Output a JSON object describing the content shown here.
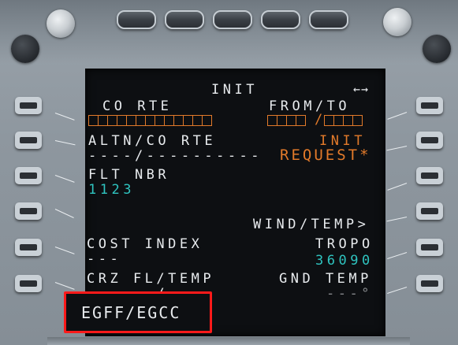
{
  "page": {
    "title": "INIT",
    "page_arrow": "←→"
  },
  "left": {
    "l1_label": "CO RTE",
    "l2_label": "ALTN/CO RTE",
    "l2_value": "----/----------",
    "l3_label": "FLT NBR",
    "l3_value": "1123",
    "l5_label": "COST INDEX",
    "l5_value": "---",
    "l6_label": "CRZ FL/TEMP",
    "l6_value": "----- /----"
  },
  "right": {
    "r1_label": "FROM/TO",
    "r2_label": "INIT",
    "r2_value": "REQUEST*",
    "r4_value": "WIND/TEMP>",
    "r5_label": "TROPO",
    "r5_value": "36090",
    "r6_label": "GND TEMP",
    "r6_value": "---°"
  },
  "scratchpad": {
    "text": "EGFF/EGCC"
  },
  "colors": {
    "white": "#e8ebee",
    "amber": "#e27a2a",
    "cyan": "#2fc4c0",
    "highlight": "#ff1a1a"
  }
}
